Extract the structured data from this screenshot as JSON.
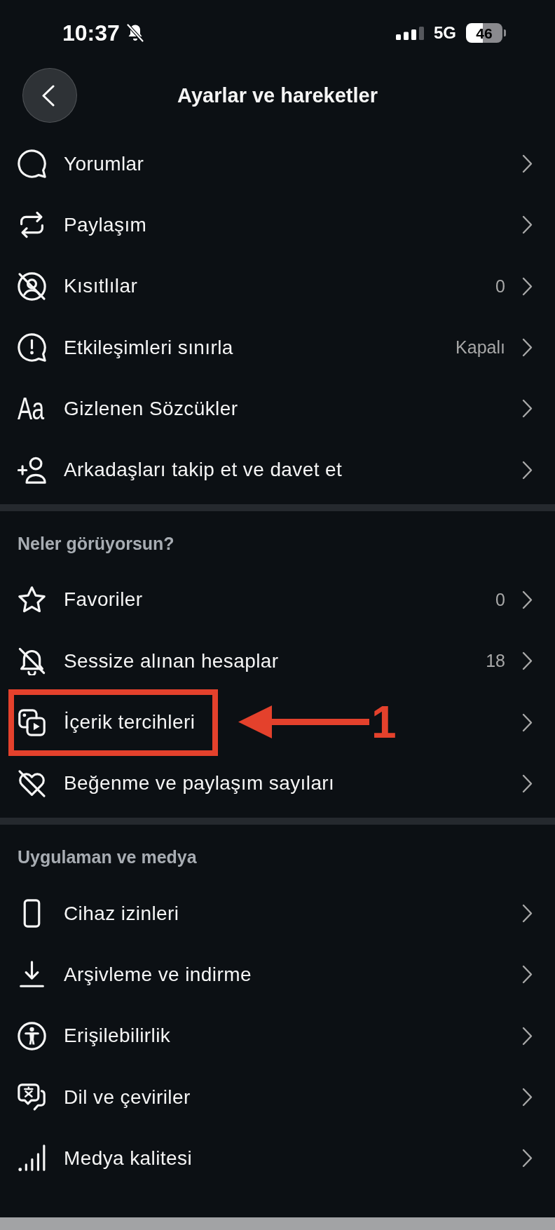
{
  "status_bar": {
    "time": "10:37",
    "network": "5G",
    "battery": "46"
  },
  "header": {
    "title": "Ayarlar ve hareketler"
  },
  "sections": [
    {
      "rows": [
        {
          "label": "Yorumlar",
          "highlighted": false
        },
        {
          "label": "Paylaşım",
          "highlighted": false
        },
        {
          "label": "Kısıtlılar",
          "value": "0",
          "highlighted": false
        },
        {
          "label": "Etkileşimleri sınırla",
          "value": "Kapalı",
          "highlighted": false
        },
        {
          "label": "Gizlenen Sözcükler",
          "icon_text": "Aa",
          "highlighted": false
        },
        {
          "label": "Arkadaşları takip et ve davet et",
          "highlighted": false
        }
      ]
    },
    {
      "title": "Neler görüyorsun?",
      "rows": [
        {
          "label": "Favoriler",
          "value": "0",
          "highlighted": false
        },
        {
          "label": "Sessize alınan hesaplar",
          "value": "18",
          "highlighted": false
        },
        {
          "label": "İçerik tercihleri",
          "highlighted": true,
          "callout": "1"
        },
        {
          "label": "Beğenme ve paylaşım sayıları",
          "highlighted": false
        }
      ]
    },
    {
      "title": "Uygulaman ve medya",
      "rows": [
        {
          "label": "Cihaz izinleri",
          "highlighted": false
        },
        {
          "label": "Arşivleme ve indirme",
          "highlighted": false
        },
        {
          "label": "Erişilebilirlik",
          "highlighted": false
        },
        {
          "label": "Dil ve çeviriler",
          "highlighted": false
        },
        {
          "label": "Medya kalitesi",
          "highlighted": false
        }
      ]
    }
  ]
}
